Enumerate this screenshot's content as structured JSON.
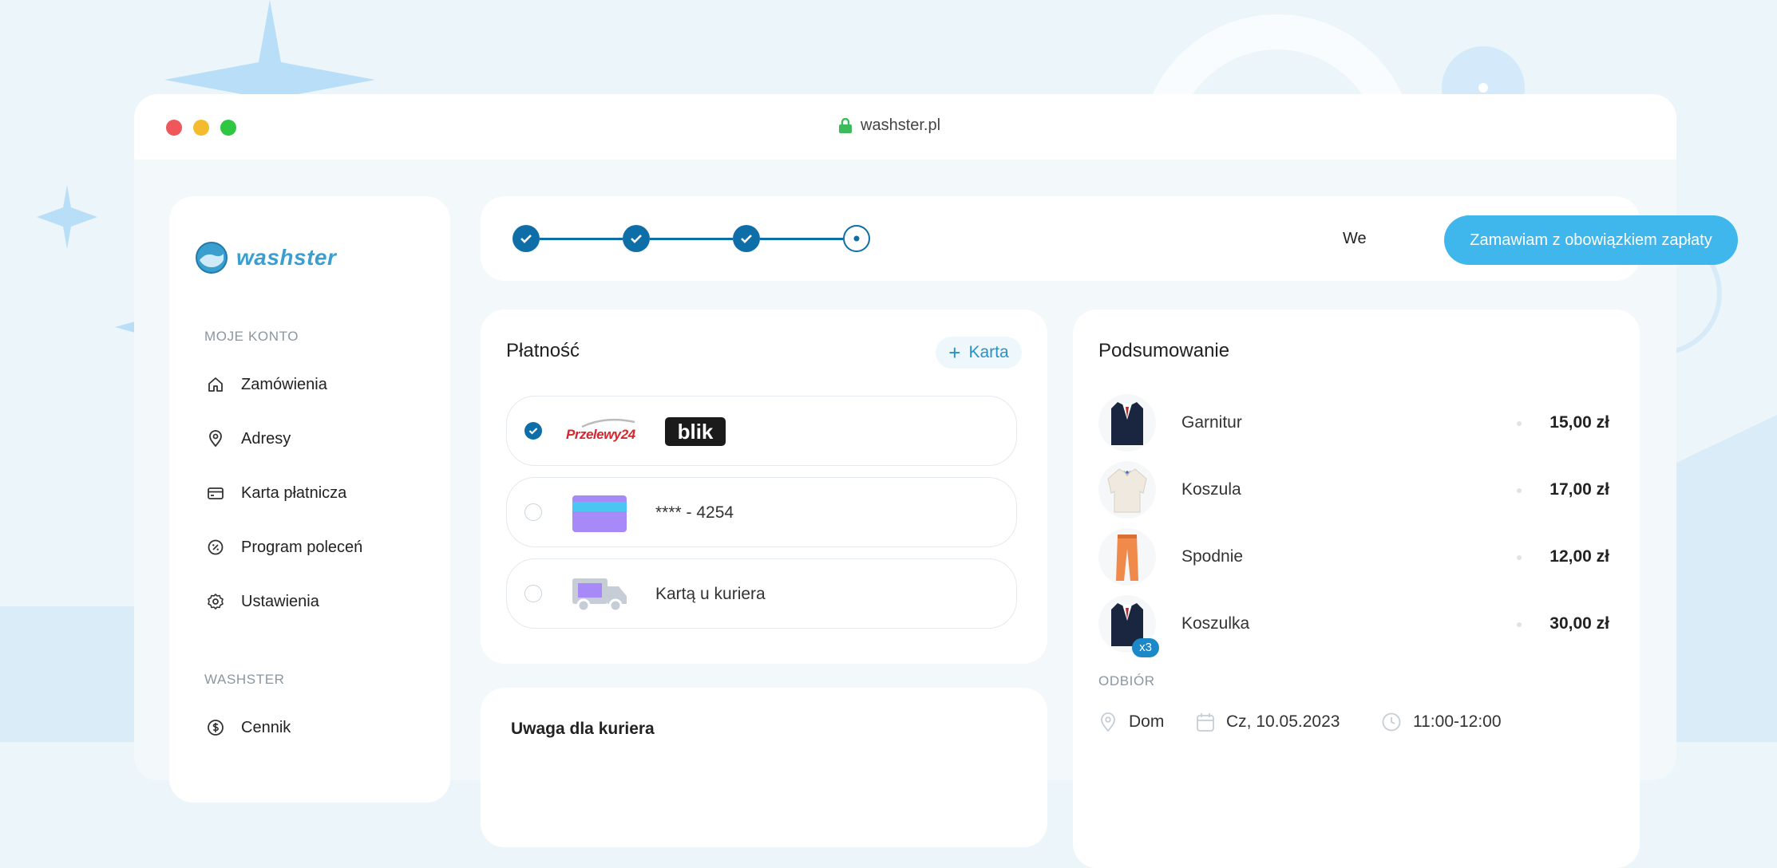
{
  "browser": {
    "url": "washster.pl",
    "colors": {
      "close": "#f0575a",
      "minimize": "#f4bb2e",
      "maximize": "#2fc742"
    }
  },
  "sidebar": {
    "logo_text": "washster",
    "section_account": "MOJE KONTO",
    "account_items": [
      {
        "label": "Zamówienia",
        "icon": "home-icon"
      },
      {
        "label": "Adresy",
        "icon": "location-pin-icon"
      },
      {
        "label": "Karta płatnicza",
        "icon": "credit-card-icon"
      },
      {
        "label": "Program poleceń",
        "icon": "percent-badge-icon"
      },
      {
        "label": "Ustawienia",
        "icon": "gear-icon"
      }
    ],
    "section_washster": "WASHSTER",
    "washster_items": [
      {
        "label": "Cennik",
        "icon": "dollar-coin-icon"
      }
    ]
  },
  "checkout": {
    "steps": [
      {
        "state": "done"
      },
      {
        "state": "done"
      },
      {
        "state": "done"
      },
      {
        "state": "current"
      }
    ],
    "truncated_label": "We",
    "cta_label": "Zamawiam z obowiązkiem zapłaty",
    "accent": "#3fb6ec",
    "primary": "#0d6ea8"
  },
  "payment": {
    "title": "Płatność",
    "add_card_label": "Karta",
    "options": [
      {
        "type": "przelewy24-blik",
        "logo_p24": "Przelewy24",
        "logo_blik": "blik",
        "checked": true
      },
      {
        "type": "saved-card",
        "label": "**** - 4254",
        "checked": false
      },
      {
        "type": "courier-card",
        "label": "Kartą u kuriera",
        "checked": false
      }
    ]
  },
  "courier_note": {
    "title": "Uwaga dla kuriera"
  },
  "summary": {
    "title": "Podsumowanie",
    "items": [
      {
        "name": "Garnitur",
        "price": "15,00 zł",
        "icon": "suit-icon"
      },
      {
        "name": "Koszula",
        "price": "17,00 zł",
        "icon": "shirt-icon"
      },
      {
        "name": "Spodnie",
        "price": "12,00 zł",
        "icon": "trousers-icon"
      },
      {
        "name": "Koszulka",
        "price": "30,00 zł",
        "icon": "suit-icon",
        "badge": "x3"
      }
    ],
    "pickup_title": "ODBIÓR",
    "pickup": {
      "place": "Dom",
      "date": "Cz, 10.05.2023",
      "time": "11:00-12:00"
    }
  }
}
